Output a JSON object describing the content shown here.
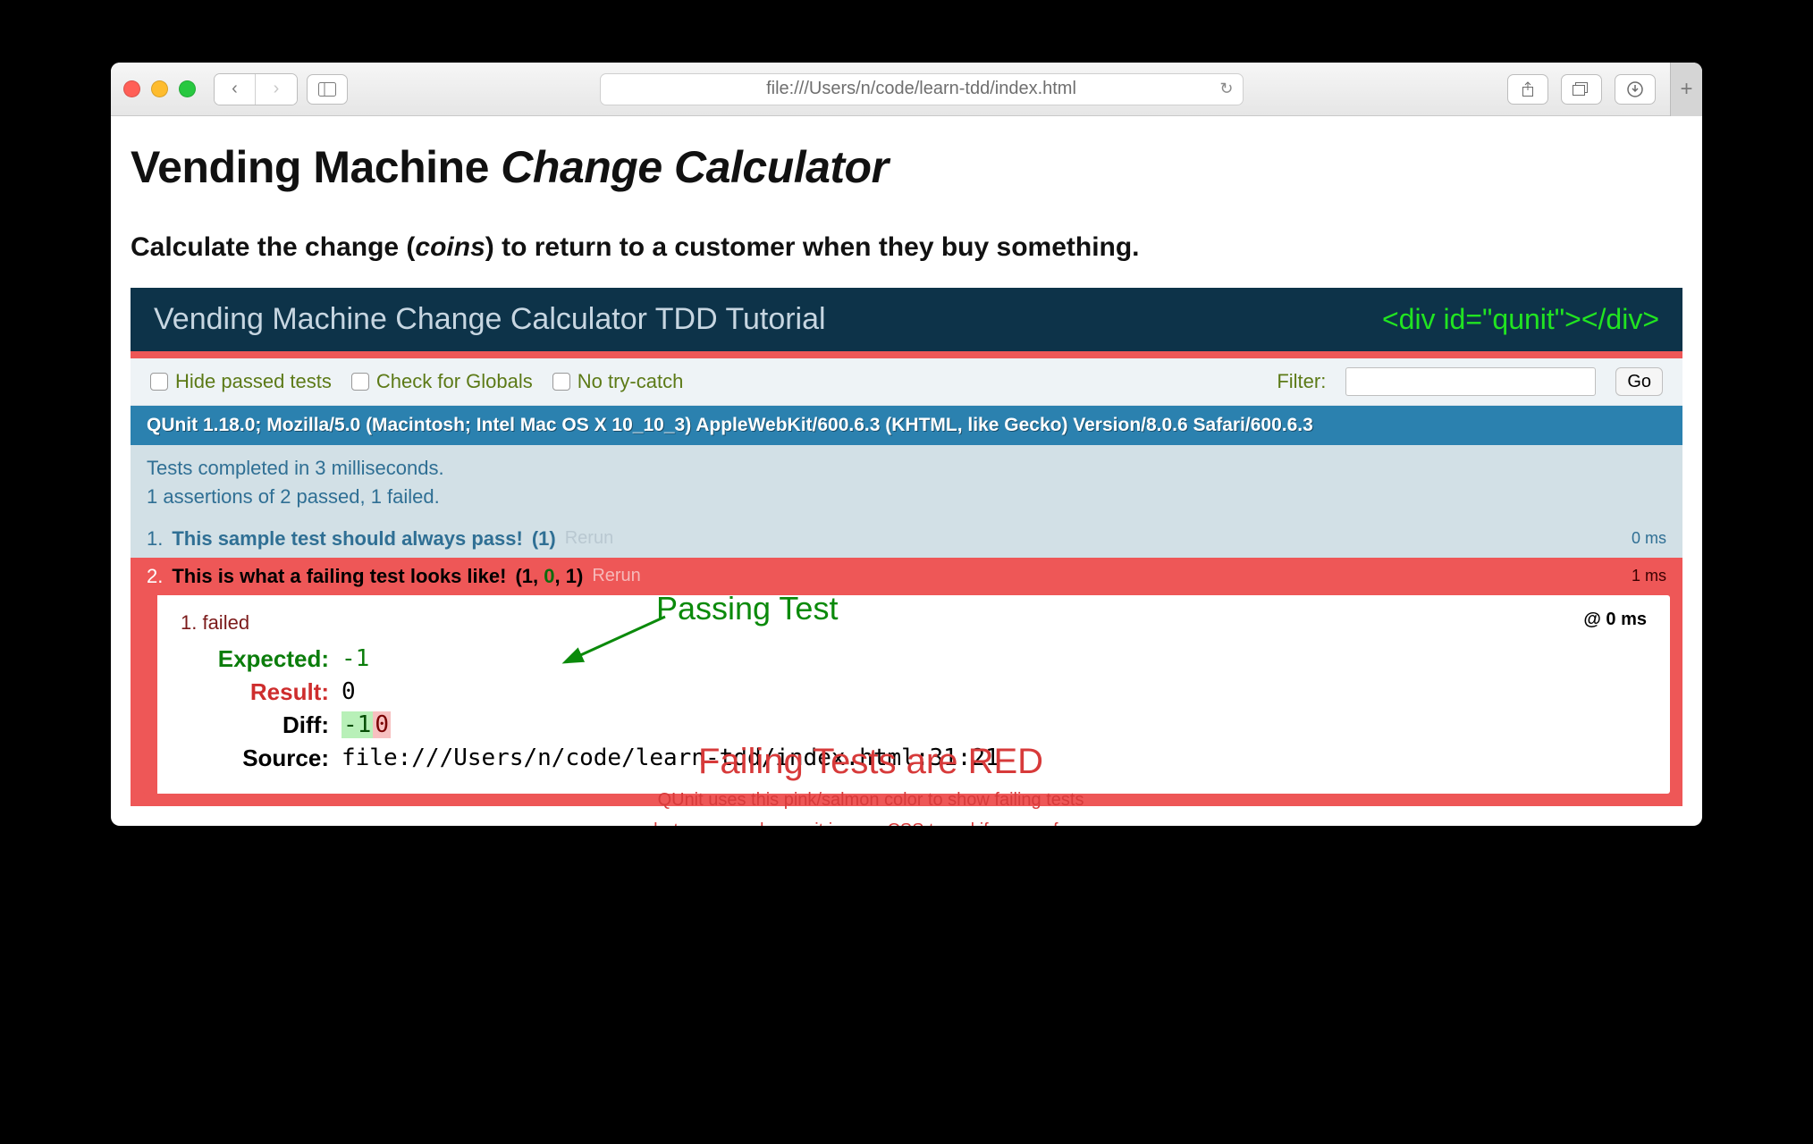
{
  "browser": {
    "url": "file:///Users/n/code/learn-tdd/index.html"
  },
  "page": {
    "title_prefix": "Vending Machine ",
    "title_em": "Change Calculator",
    "subtitle_pre": "Calculate the change (",
    "subtitle_em": "coins",
    "subtitle_post": ") to return to a customer when they buy something."
  },
  "qunit": {
    "header": "Vending Machine Change Calculator TDD Tutorial",
    "annot_header": "<div id=\"qunit\"></div>",
    "toolbar": {
      "hide_passed": "Hide passed tests",
      "check_globals": "Check for Globals",
      "no_trycatch": "No try-catch",
      "filter_label": "Filter:",
      "go": "Go"
    },
    "ua": "QUnit 1.18.0; Mozilla/5.0 (Macintosh; Intel Mac OS X 10_10_3) AppleWebKit/600.6.3 (KHTML, like Gecko) Version/8.0.6 Safari/600.6.3",
    "summary_line1": "Tests completed in 3 milliseconds.",
    "summary_line2": "1 assertions of 2 passed, 1 failed.",
    "tests": {
      "pass": {
        "idx": "1.",
        "name": "This sample test should always pass!",
        "count": "(1)",
        "rerun": "Rerun",
        "time": "0 ms"
      },
      "fail": {
        "idx": "2.",
        "name": "This is what a failing test looks like!",
        "count_open": "(",
        "count_total": "1",
        "count_sep1": ", ",
        "count_pass": "0",
        "count_sep2": ", ",
        "count_fail": "1",
        "count_close": ")",
        "rerun": "Rerun",
        "time": "1 ms"
      }
    },
    "detail": {
      "line": "1. failed",
      "at": "@ 0 ms",
      "expected_k": "Expected:",
      "expected_v": "-1",
      "result_k": "Result:",
      "result_v": "0",
      "diff_k": "Diff:",
      "diff_del": "-1",
      "diff_ins": "0",
      "source_k": "Source:",
      "source_v": "file:///Users/n/code/learn-tdd/index.html:31:21"
    }
  },
  "annotations": {
    "passing": "Passing Test",
    "failing_big": "Failing Tests are RED",
    "failing_small1": "QUnit uses this pink/salmon color to show failing tests",
    "failing_small2": "but you can change it in your CSS to red if you prefer..."
  }
}
